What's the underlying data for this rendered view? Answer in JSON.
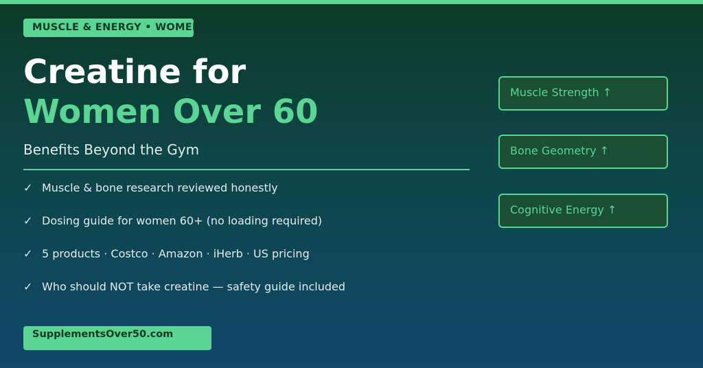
{
  "category_badge": "MUSCLE & ENERGY • WOMEN",
  "title": {
    "line1": "Creatine for",
    "line2": "Women Over 60"
  },
  "subtitle": "Benefits Beyond the Gym",
  "benefits": [
    {
      "check": "✓",
      "text": "Muscle & bone research reviewed honestly"
    },
    {
      "check": "✓",
      "text": "Dosing guide for women 60+ (no loading required)"
    },
    {
      "check": "✓",
      "text": "5 products · Costco · Amazon · iHerb · US pricing"
    },
    {
      "check": "✓",
      "text": "Who should NOT take creatine — safety guide included"
    }
  ],
  "site": "SupplementsOver50.com",
  "pills": [
    {
      "label": "Muscle Strength ↑"
    },
    {
      "label": "Bone Geometry ↑"
    },
    {
      "label": "Cognitive Energy ↑"
    }
  ],
  "colors": {
    "accent": "#5ad593",
    "background_top": "#0c3a27",
    "background_bottom": "#10476b",
    "pill_fill": "#1a4f34",
    "text_light": "#e2ece8"
  }
}
